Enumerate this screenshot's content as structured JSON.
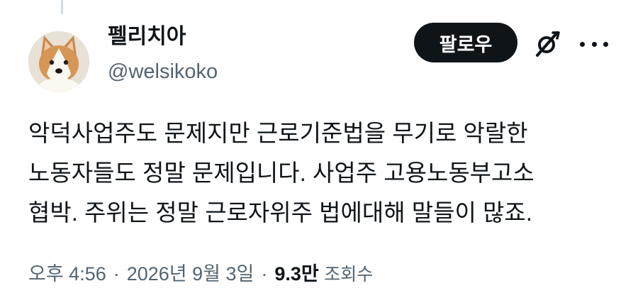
{
  "author": {
    "display_name": "펠리치아",
    "handle": "@welsikoko",
    "avatar_icon": "corgi-avatar"
  },
  "actions": {
    "follow_label": "팔로우",
    "grok_icon": "grok-icon",
    "more_icon": "more-icon"
  },
  "tweet": {
    "lines": [
      "악덕사업주도 문제지만 근로기준법을 무기로 악랄한",
      "노동자들도 정말 문제입니다. 사업주 고용노동부고소",
      "협박. 주위는 정말 근로자위주 법에대해 말들이 많죠."
    ]
  },
  "meta": {
    "time": "오후 4:56",
    "separator": "·",
    "date": "2026년 9월 3일",
    "views_count": "9.3만",
    "views_label": "조회수"
  },
  "colors": {
    "text_primary": "#0f1419",
    "text_secondary": "#536471",
    "follow_bg": "#0f1419",
    "thread_line": "#cfd9de"
  }
}
